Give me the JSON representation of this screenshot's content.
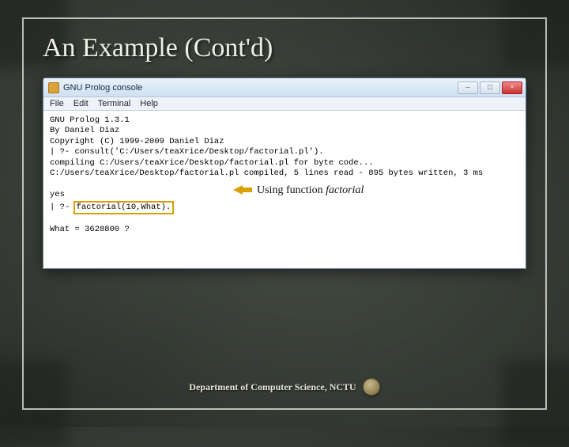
{
  "slide": {
    "title": "An Example (Cont'd)",
    "footer": "Department of Computer Science, NCTU"
  },
  "window": {
    "title": "GNU Prolog console",
    "controls": {
      "minimize": "–",
      "maximize": "□",
      "close": "×"
    },
    "menu": [
      "File",
      "Edit",
      "Terminal",
      "Help"
    ]
  },
  "console": {
    "line1": "GNU Prolog 1.3.1",
    "line2": "By Daniel Diaz",
    "line3": "Copyright (C) 1999-2009 Daniel Diaz",
    "line4": "| ?- consult('C:/Users/teaXrice/Desktop/factorial.pl').",
    "line5": "compiling C:/Users/teaXrice/Desktop/factorial.pl for byte code...",
    "line6": "C:/Users/teaXrice/Desktop/factorial.pl compiled, 5 lines read - 895 bytes written, 3 ms",
    "blank": "",
    "yes": "yes",
    "query_prefix": "| ?- ",
    "query": "factorial(10,What).",
    "result": "What = 3628800 ?"
  },
  "annotation": {
    "prefix": "Using function ",
    "emph": "factorial"
  }
}
